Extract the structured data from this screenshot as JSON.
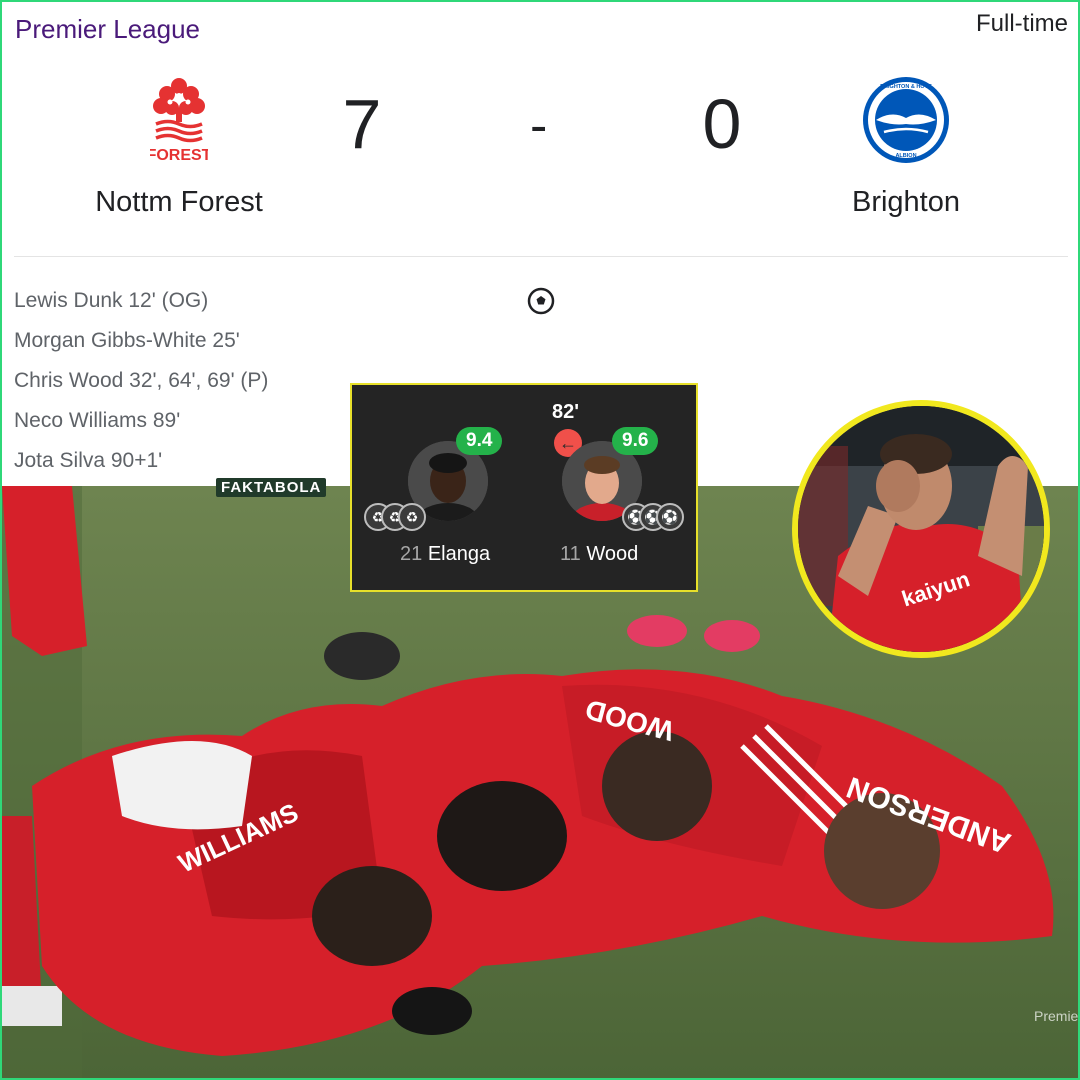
{
  "competition": "Premier League",
  "match_status": "Full-time",
  "home": {
    "name": "Nottm Forest",
    "score": "7",
    "crest_text": "FOREST"
  },
  "away": {
    "name": "Brighton",
    "score": "0",
    "crest_text": "BRIGHTON & HOVE ALBION"
  },
  "score_separator": "-",
  "goalscorers": [
    "Lewis Dunk 12' (OG)",
    "Morgan Gibbs-White 25'",
    "Chris Wood 32', 64', 69' (P)",
    "Neco Williams 89'",
    "Jota Silva 90+1'"
  ],
  "watermark": "FAKTABOLA",
  "player_stats": {
    "players": [
      {
        "number": "21",
        "name": "Elanga",
        "rating": "9.4",
        "badges": [
          "assist-boot-icon",
          "assist-boot-icon",
          "assist-boot-icon"
        ]
      },
      {
        "number": "11",
        "name": "Wood",
        "rating": "9.6",
        "sub_minute": "82'",
        "badges": [
          "goal-ball-icon",
          "goal-ball-icon",
          "goal-ball-icon"
        ]
      }
    ]
  },
  "photo": {
    "shirt_names": [
      "WOOD",
      "ANDERSON",
      "WILLIAMS"
    ],
    "sponsor": "kaiyun",
    "broadcast_logo": "Premier"
  },
  "colors": {
    "forest_red": "#d6202a",
    "brighton_blue": "#0057b8",
    "rating_green": "#24b24a",
    "frame_green": "#2fd879",
    "highlight_yellow": "#f1e81e"
  }
}
